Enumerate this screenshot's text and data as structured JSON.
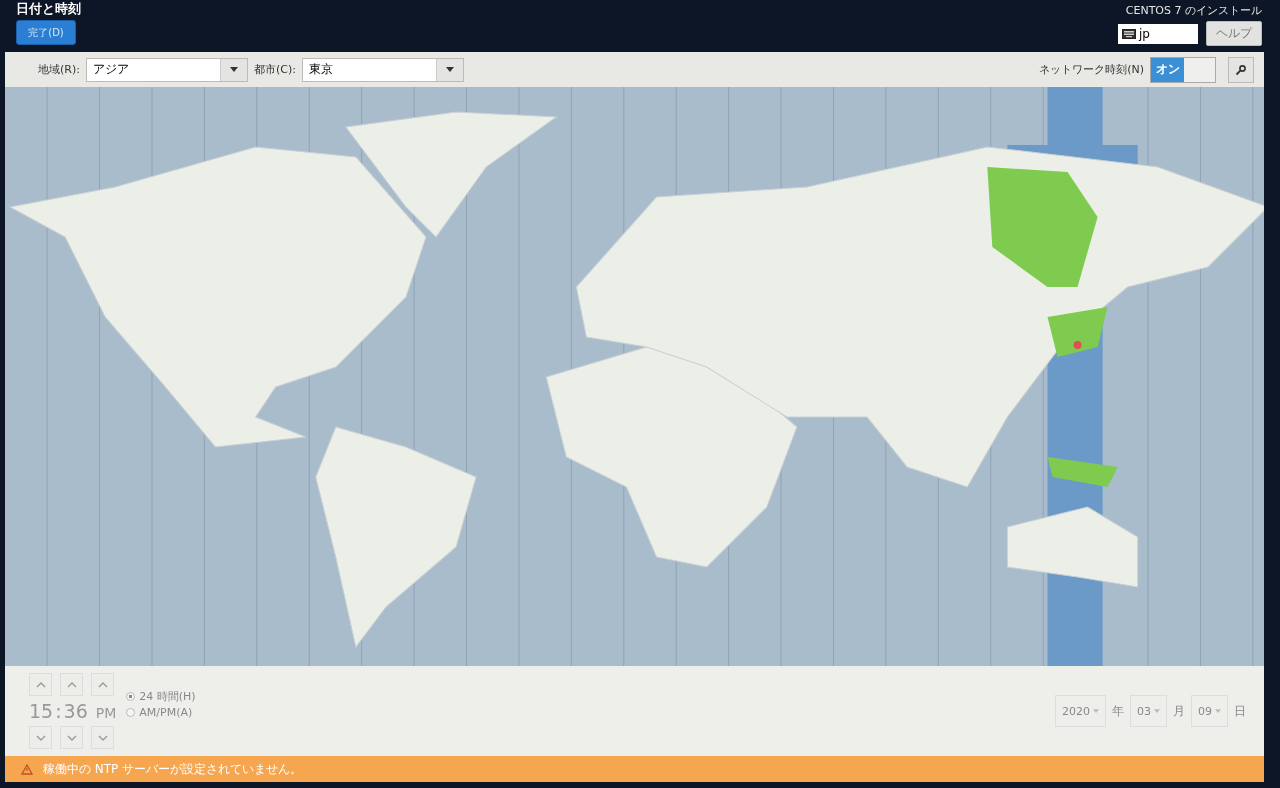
{
  "header": {
    "title": "日付と時刻",
    "done_button": "完了(D)",
    "product": "CENTOS 7 のインストール",
    "keyboard_layout": "jp",
    "help_button": "ヘルプ"
  },
  "toolbar": {
    "region": {
      "label": "地域(R):",
      "value": "アジア"
    },
    "city": {
      "label": "都市(C):",
      "value": "東京"
    },
    "network_time": {
      "label": "ネットワーク時刻(N)",
      "switch_label": "オン",
      "on": true
    }
  },
  "time": {
    "hours": "15",
    "separator": ":",
    "minutes": "36",
    "period": "PM",
    "formats": [
      {
        "label": "24 時間(H)",
        "selected": true
      },
      {
        "label": "AM/PM(A)",
        "selected": false
      }
    ]
  },
  "date": {
    "year": "2020",
    "year_unit": "年",
    "month": "03",
    "month_unit": "月",
    "day": "09",
    "day_unit": "日"
  },
  "warning": "稼働中の NTP サーバーが設定されていません。"
}
